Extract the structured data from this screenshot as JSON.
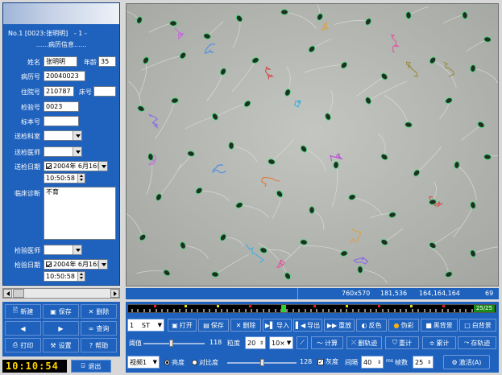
{
  "patient_panel": {
    "header_text": "No.1 [0023:张明明]   - 1 -",
    "section_title": "......病历信息......",
    "name_label": "姓名",
    "name_value": "张明明",
    "age_label": "年龄",
    "age_value": "35",
    "record_no_label": "病历号",
    "record_no_value": "20040023",
    "inpatient_no_label": "住院号",
    "inpatient_no_value": "210787",
    "bed_no_label": "床号",
    "bed_no_value": "",
    "exam_no_label": "检验号",
    "exam_no_value": "0023",
    "specimen_no_label": "标本号",
    "specimen_no_value": "",
    "dept_label": "送检科室",
    "dept_value": "",
    "doctor_label": "送检医师",
    "doctor_value": "",
    "send_date_label": "送检日期",
    "send_date_value": "2004年 6月16日",
    "send_time_value": "10:50:58",
    "diagnosis_label": "临床诊断",
    "diagnosis_value": "不育",
    "exam_doctor_label": "检验医师",
    "exam_doctor_value": "",
    "exam_date_label": "检验日期",
    "exam_date_value": "2004年 6月16日",
    "exam_time_value": "10:50:58"
  },
  "left_buttons": {
    "new": "新建",
    "save": "保存",
    "delete": "删除",
    "query": "查询",
    "print": "打印",
    "settings": "设置",
    "help": "帮助"
  },
  "clock": "10:10:54",
  "exit_label": "退出",
  "status_bar": {
    "resolution": "760x570",
    "coords": "181,536",
    "rgb": "164,164,164",
    "value": "69"
  },
  "timeline": {
    "counter": "25/25"
  },
  "toolbar_row1": {
    "frame_select": "1",
    "frame_unit": "ST",
    "open": "打开",
    "save": "保存",
    "delete": "删除",
    "import": "导入",
    "export": "导出",
    "replay": "重放",
    "invert": "反色",
    "pseudo_color": "伪彩",
    "black_bg": "黑背景",
    "white_bg": "白背景"
  },
  "toolbar_row2": {
    "threshold_label": "阈值",
    "threshold_value": "118",
    "threshold_fraction": 0.45,
    "granularity_label": "粒度",
    "granularity_value": "20",
    "zoom_value": "10×",
    "calc": "计算",
    "clear_track": "删轨迹",
    "recount": "重计",
    "accumulate": "累计",
    "save_track": "存轨迹"
  },
  "toolbar_row3": {
    "video_select": "视频1",
    "brightness_label": "亮度",
    "contrast_label": "对比度",
    "slider_value": "128",
    "slider_fraction": 0.5,
    "gray_label": "灰度",
    "interval_label": "间隔",
    "interval_value": "40",
    "interval_unit": "ms",
    "frames_label": "帧数",
    "frames_value": "25",
    "activate": "激活(A)"
  }
}
